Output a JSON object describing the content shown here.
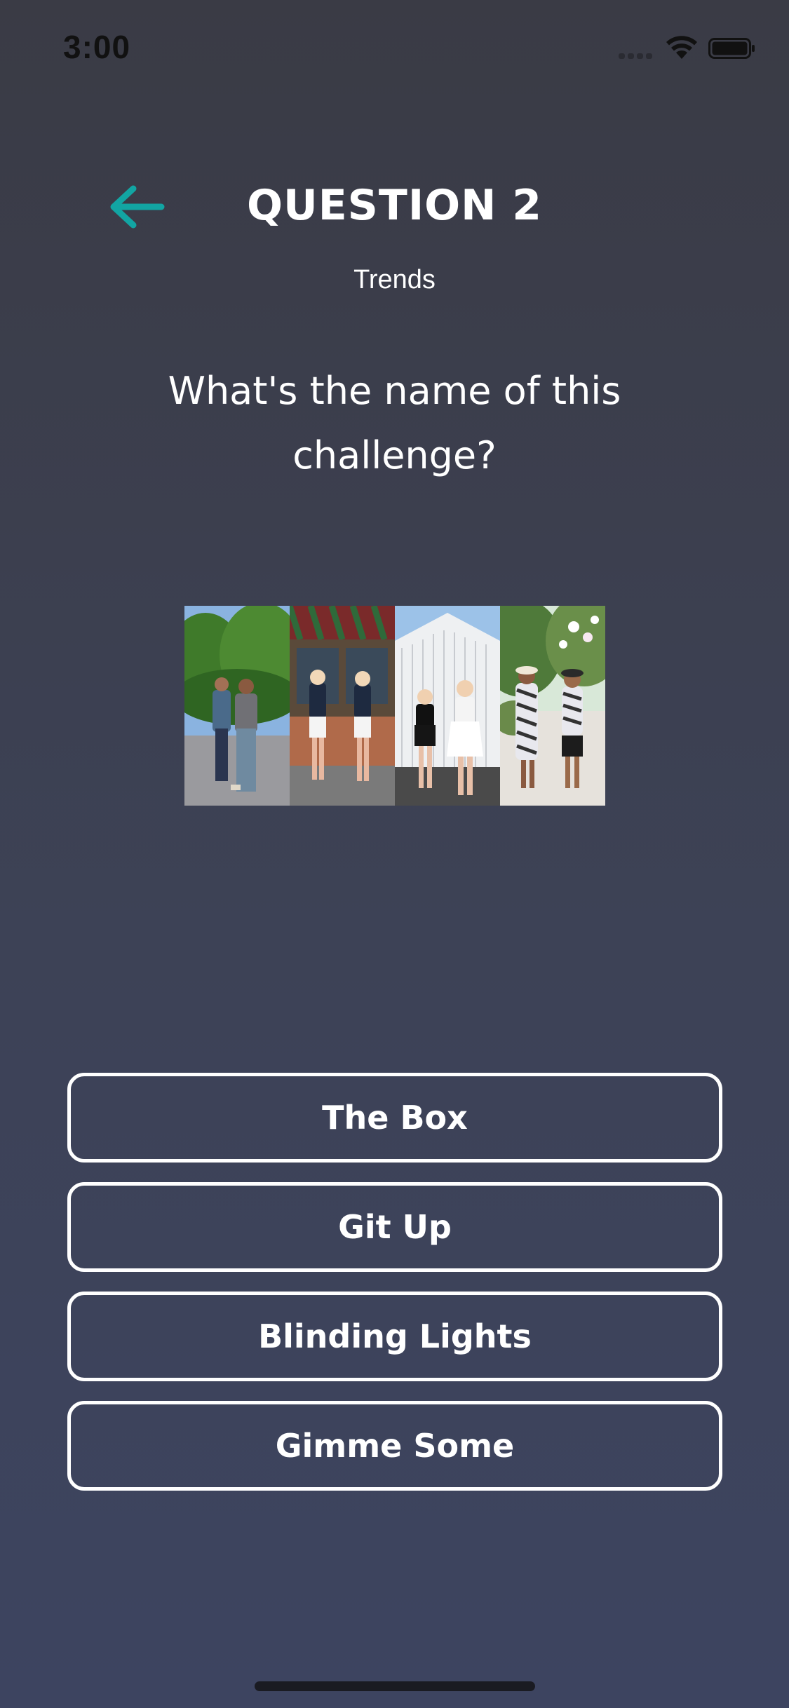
{
  "status_bar": {
    "time": "3:00"
  },
  "header": {
    "back_icon": "arrow-left-icon",
    "title": "QUESTION 2",
    "category": "Trends"
  },
  "question": {
    "text": "What's the name of this challenge?"
  },
  "image": {
    "panel_count": 4
  },
  "answers": [
    {
      "label": "The Box"
    },
    {
      "label": "Git Up"
    },
    {
      "label": "Blinding Lights"
    },
    {
      "label": "Gimme Some"
    }
  ],
  "colors": {
    "accent": "#12a5a3",
    "background_top": "#3a3b45",
    "background_bottom": "#3d4460",
    "text": "#ffffff",
    "button_border": "#ffffff"
  }
}
